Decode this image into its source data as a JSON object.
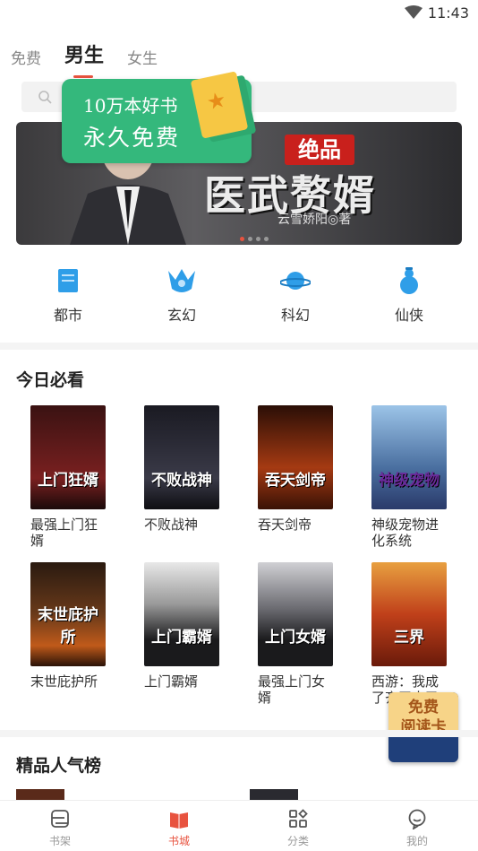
{
  "status": {
    "time": "11:43"
  },
  "top_tabs": [
    {
      "label": "免费"
    },
    {
      "label": "男生"
    },
    {
      "label": "女生"
    }
  ],
  "promo": {
    "line1": "10万本好书",
    "line2": "永久免费"
  },
  "banner": {
    "badge": "绝品",
    "title": "医武赘婿",
    "author": "云雪娇阳◎著"
  },
  "categories": [
    {
      "label": "都市",
      "icon": "city-icon"
    },
    {
      "label": "玄幻",
      "icon": "fantasy-icon"
    },
    {
      "label": "科幻",
      "icon": "scifi-icon"
    },
    {
      "label": "仙侠",
      "icon": "xianxia-icon"
    }
  ],
  "today": {
    "title": "今日必看",
    "books": [
      {
        "name": "最强上门狂婿",
        "cover_text": "上门狂婿",
        "color": "#5a1c1c"
      },
      {
        "name": "不败战神",
        "cover_text": "不败战神",
        "color": "#2a2a32"
      },
      {
        "name": "吞天剑帝",
        "cover_text": "吞天剑帝",
        "color": "#6a2410"
      },
      {
        "name": "神级宠物进化系统",
        "cover_text": "神级宠物",
        "color": "#4a6fa0"
      },
      {
        "name": "末世庇护所",
        "cover_text": "末世庇护所",
        "color": "#3b2414"
      },
      {
        "name": "上门霸婿",
        "cover_text": "上门霸婿",
        "color": "#202022"
      },
      {
        "name": "最强上门女婿",
        "cover_text": "上门女婿",
        "color": "#26262a"
      },
      {
        "name": "西游：我成了齐天大圣",
        "cover_text": "三界",
        "color": "#a8321a"
      }
    ]
  },
  "rank": {
    "title": "精品人气榜"
  },
  "read_card": {
    "line1": "免费",
    "line2": "阅读卡"
  },
  "bottom_nav": [
    {
      "label": "书架",
      "icon": "bookshelf-icon"
    },
    {
      "label": "书城",
      "icon": "bookstore-icon"
    },
    {
      "label": "分类",
      "icon": "category-icon"
    },
    {
      "label": "我的",
      "icon": "profile-icon"
    }
  ],
  "colors": {
    "accent": "#e8533f",
    "promo_green": "#34b87c",
    "category_blue": "#2f9ee8"
  }
}
